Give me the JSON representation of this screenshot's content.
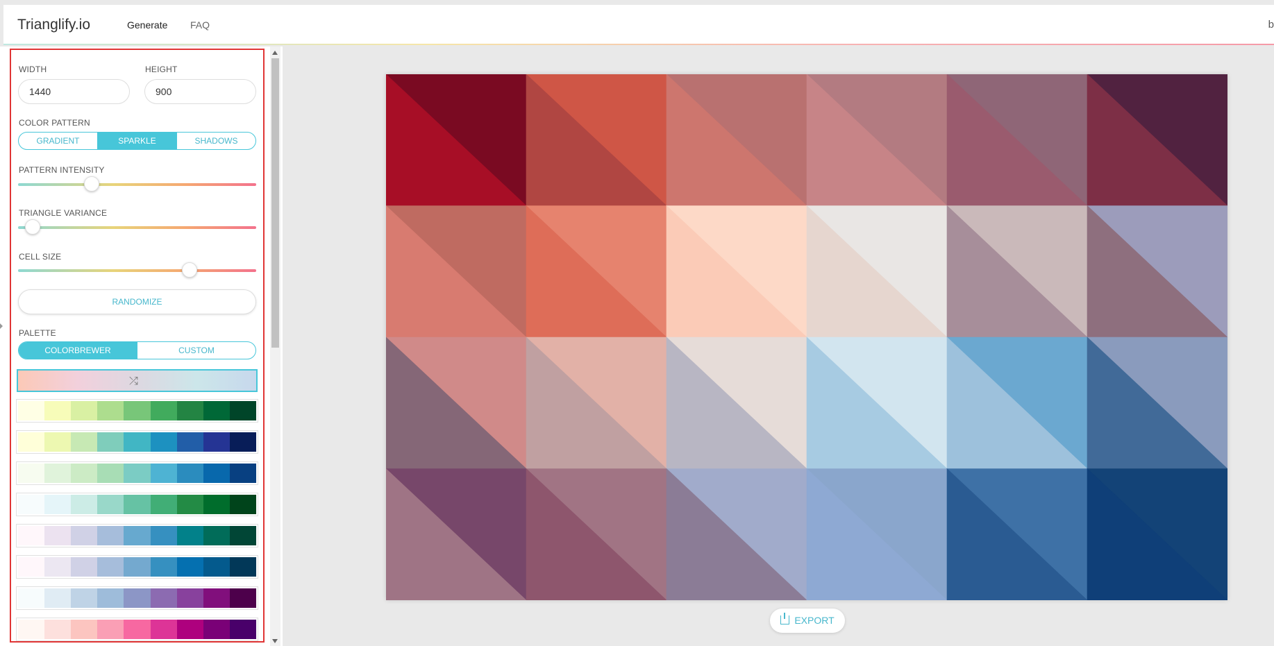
{
  "nav": {
    "brand": "Trianglify.io",
    "links": [
      "Generate",
      "FAQ"
    ],
    "edge_text": "b"
  },
  "sidebar": {
    "width_label": "WIDTH",
    "width_value": "1440",
    "height_label": "HEIGHT",
    "height_value": "900",
    "color_pattern_label": "COLOR PATTERN",
    "color_pattern_options": [
      "GRADIENT",
      "SPARKLE",
      "SHADOWS"
    ],
    "color_pattern_selected": "SPARKLE",
    "pattern_intensity_label": "PATTERN INTENSITY",
    "pattern_intensity": 0.31,
    "triangle_variance_label": "TRIANGLE VARIANCE",
    "triangle_variance": 0.06,
    "cell_size_label": "CELL SIZE",
    "cell_size": 0.72,
    "randomize_label": "RANDOMIZE",
    "palette_label": "PALETTE",
    "palette_tabs": [
      "COLORBREWER",
      "CUSTOM"
    ],
    "palette_tab_selected": "COLORBREWER",
    "selected_palette_colors": [
      "#fcc9b7",
      "#f2d0dc",
      "#ddd8e1",
      "#cce6ea",
      "#c7d8ec"
    ],
    "palettes": [
      [
        "#ffffe5",
        "#f7fcb9",
        "#d9f0a3",
        "#addd8e",
        "#78c679",
        "#41ab5d",
        "#238443",
        "#006837",
        "#004529"
      ],
      [
        "#ffffd9",
        "#edf8b1",
        "#c7e9b4",
        "#7fcdbb",
        "#41b6c4",
        "#1d91c0",
        "#225ea8",
        "#253494",
        "#081d58"
      ],
      [
        "#f7fcf0",
        "#e0f3db",
        "#ccebc5",
        "#a8ddb5",
        "#7bccc4",
        "#4eb3d3",
        "#2b8cbe",
        "#0868ac",
        "#084081"
      ],
      [
        "#f7fcfd",
        "#e5f5f9",
        "#ccece6",
        "#99d8c9",
        "#66c2a4",
        "#41ae76",
        "#238b45",
        "#006d2c",
        "#00441b"
      ],
      [
        "#fff7fb",
        "#ece2f0",
        "#d0d1e6",
        "#a6bddb",
        "#67a9cf",
        "#3690c0",
        "#02818a",
        "#016c59",
        "#014636"
      ],
      [
        "#fff7fb",
        "#ece7f2",
        "#d0d1e6",
        "#a6bddb",
        "#74a9cf",
        "#3690c0",
        "#0570b0",
        "#045a8d",
        "#023858"
      ],
      [
        "#f7fcfd",
        "#e0ecf4",
        "#bfd3e6",
        "#9ebcda",
        "#8c96c6",
        "#8c6bb1",
        "#88419d",
        "#810f7c",
        "#4d004b"
      ],
      [
        "#fff7f3",
        "#fde0dd",
        "#fcc5c0",
        "#fa9fb5",
        "#f768a1",
        "#dd3497",
        "#ae017e",
        "#7a0177",
        "#49006a"
      ]
    ]
  },
  "main": {
    "export_label": "EXPORT",
    "pattern_rows": [
      [
        "#7a0a22",
        "#a70e26",
        "#cf5646",
        "#b04642",
        "#b97170",
        "#cd766e",
        "#b37b81",
        "#c78487",
        "#8f6677",
        "#9a5b6e",
        "#512240",
        "#7d2f46"
      ],
      [
        "#bf6b61",
        "#d87b70",
        "#e6836e",
        "#de6d58",
        "#fdd9c7",
        "#fbcbb7",
        "#e9e6e4",
        "#e6d6cf",
        "#cab9ba",
        "#a78e9a",
        "#9c9cbb",
        "#8e6f7e"
      ],
      [
        "#d08a89",
        "#856777",
        "#e2b1a7",
        "#c0a0a1",
        "#e6dcd8",
        "#b8b6c3",
        "#d2e5ef",
        "#a7cbe2",
        "#6ba8d0",
        "#9dc1dc",
        "#8a9bbd",
        "#416a98"
      ],
      [
        "#77476a",
        "#9f7485",
        "#a17484",
        "#8e566d",
        "#a1abcb",
        "#8b7c96",
        "#8aa6cc",
        "#8ea9d3",
        "#3e71a6",
        "#2a5b92",
        "#134377",
        "#0f3f78"
      ]
    ]
  }
}
